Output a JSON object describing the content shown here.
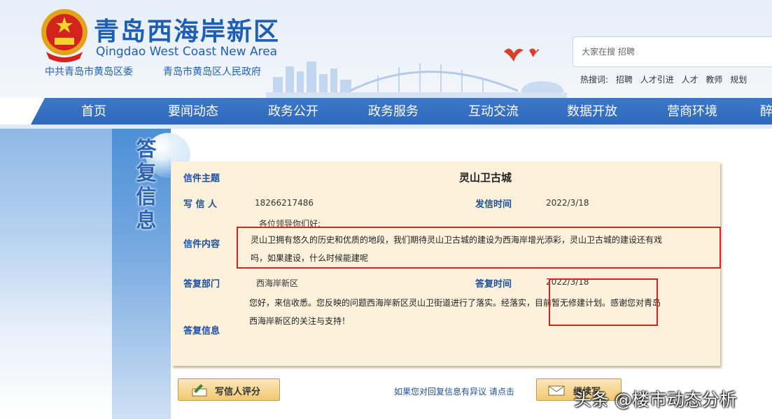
{
  "header": {
    "title": "青岛西海岸新区",
    "subtitle": "Qingdao West Coast New Area",
    "org_party": "中共青岛市黄岛区委",
    "org_gov": "青岛市黄岛区人民政府"
  },
  "search": {
    "placeholder": "大家在搜 招聘",
    "hot_label": "热搜词:",
    "hot_words": [
      "招聘",
      "人才引进",
      "人才",
      "教师",
      "规划"
    ]
  },
  "nav": {
    "items": [
      "首页",
      "要闻动态",
      "政务公开",
      "政务服务",
      "互动交流",
      "数据开放",
      "营商环境",
      "醉"
    ]
  },
  "section": {
    "title_chars": [
      "答",
      "复",
      "信",
      "息"
    ]
  },
  "letter": {
    "subject_label": "信件主题",
    "subject": "灵山卫古城",
    "writer_label": "写 信 人",
    "writer": "18266217486",
    "sent_label": "发信时间",
    "sent": "2022/3/18",
    "content_label": "信件内容",
    "greeting": "各位领导你们好:",
    "content_line1": "灵山卫拥有悠久的历史和优质的地段，我们期待灵山卫古城的建设为西海岸增光添彩，灵山卫古城的建设还有戏",
    "content_line2": "吗，如果建设，什么时候能建呢",
    "dept_label": "答复部门",
    "dept": "西海岸新区",
    "reply_time_label": "答复时间",
    "reply_time": "2022/3/18",
    "reply_label": "答复信息",
    "reply_line1": "您好，来信收悉。您反映的问题西海岸新区灵山卫街道进行了落实。经落实，目前暂无修建计划。感谢您对青岛",
    "reply_line2": "西海岸新区的关注与支持！"
  },
  "footer": {
    "rate_button": "写信人评分",
    "dispute_link": "如果您对回复信息有异议 请点击",
    "write_button": "继续写",
    "watermark": "头条 @楼市动态分析"
  },
  "colors": {
    "brand_blue": "#1d5fb7",
    "nav_blue": "#3470c3",
    "panel_bg": "#fdf1db",
    "highlight_red": "#e02020"
  }
}
